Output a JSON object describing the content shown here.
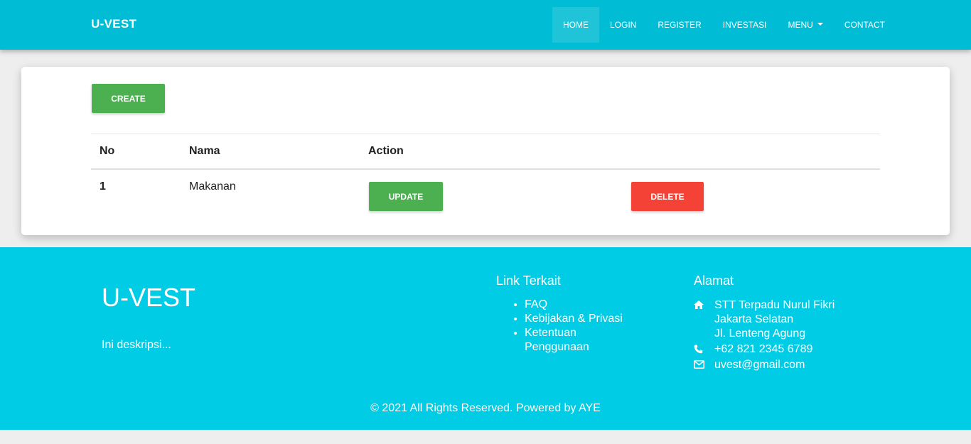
{
  "navbar": {
    "brand": "U-VEST",
    "items": [
      "HOME",
      "LOGIN",
      "REGISTER",
      "INVESTASI",
      "MENU",
      "CONTACT"
    ]
  },
  "content": {
    "create_label": "CREATE",
    "headers": {
      "no": "No",
      "nama": "Nama",
      "action": "Action"
    },
    "rows": [
      {
        "no": "1",
        "nama": "Makanan",
        "update_label": "UPDATE",
        "delete_label": "DELETE"
      }
    ]
  },
  "footer": {
    "title": "U-VEST",
    "description": "Ini deskripsi...",
    "links_heading": "Link Terkait",
    "links": [
      "FAQ",
      "Kebijakan & Privasi",
      "Ketentuan Penggunaan"
    ],
    "address_heading": "Alamat",
    "address_lines": [
      "STT Terpadu Nurul Fikri",
      "Jakarta Selatan",
      "Jl. Lenteng Agung"
    ],
    "phone": "+62 821 2345 6789",
    "email": "uvest@gmail.com",
    "copyright": "© 2021 All Rights Reserved. Powered by AYE"
  },
  "icons": {
    "address": "home-icon",
    "phone": "phone-icon",
    "email": "envelope-icon"
  },
  "colors": {
    "navbar": "#00bcd4",
    "footer": "#00cce5",
    "primary_button": "#4caf50",
    "danger_button": "#f44336"
  }
}
